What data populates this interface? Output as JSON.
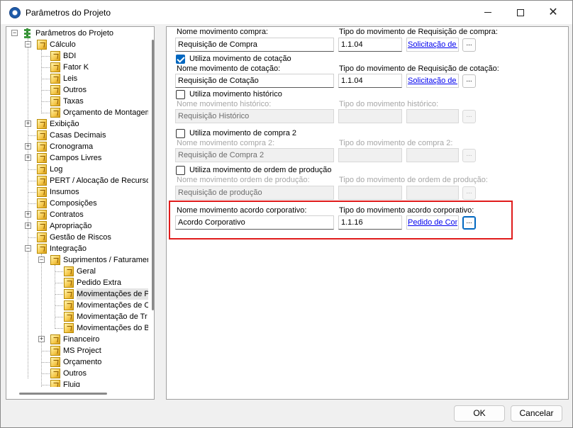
{
  "window": {
    "title": "Parâmetros do Projeto"
  },
  "tree": {
    "items": [
      "Parâmetros do Projeto",
      "Cálculo",
      "BDI",
      "Fator K",
      "Leis",
      "Outros",
      "Taxas",
      "Orçamento de Montagem",
      "Exibição",
      "Casas Decimais",
      "Cronograma",
      "Campos Livres",
      "Log",
      "PERT / Alocação de Recursos",
      "Insumos",
      "Composições",
      "Contratos",
      "Apropriação",
      "Gestão de Riscos",
      "Integração",
      "Suprimentos / Faturamento",
      "Geral",
      "Pedido Extra",
      "Movimentações de P",
      "Movimentações de C",
      "Movimentação de Tr",
      "Movimentações do B",
      "Financeiro",
      "MS Project",
      "Orçamento",
      "Outros",
      "Fluig"
    ]
  },
  "panel": {
    "compra": {
      "name_label": "Nome movimento compra:",
      "name_value": "Requisição de Compra",
      "type_label": "Tipo do movimento de Requisição de compra:",
      "type_value": "1.1.04",
      "link": "Solicitação de Compra",
      "ellipsis": "..."
    },
    "cotacao": {
      "check_label": "Utiliza movimento de cotação",
      "name_label": "Nome movimento de cotação:",
      "name_value": "Requisição de Cotação",
      "type_label": "Tipo do movimento de Requisição de cotação:",
      "type_value": "1.1.04",
      "link": "Solicitação de Compra",
      "ellipsis": "..."
    },
    "historico": {
      "check_label": "Utiliza movimento histórico",
      "name_label": "Nome movimento histórico:",
      "name_value": "Requisição Histórico",
      "type_label": "Tipo do movimento histórico:",
      "ellipsis": "..."
    },
    "compra2": {
      "check_label": "Utiliza movimento de compra 2",
      "name_label": "Nome movimento compra 2:",
      "name_value": "Requisição de Compra 2",
      "type_label": "Tipo do movimento de compra 2:",
      "ellipsis": "..."
    },
    "producao": {
      "check_label": "Utiliza movimento de ordem de produção",
      "name_label": "Nome movimento ordem de produção:",
      "name_value": "Requisição de produção",
      "type_label": "Tipo do movimento de ordem de produção:",
      "ellipsis": "..."
    },
    "corporativo": {
      "name_label": "Nome movimento acordo corporativo:",
      "name_value": "Acordo Corporativo",
      "type_label": "Tipo do movimento acordo corporativo:",
      "type_value": "1.1.16",
      "link": "Pedido de Compra",
      "ellipsis": "..."
    }
  },
  "footer": {
    "ok": "OK",
    "cancel": "Cancelar"
  },
  "colors": {
    "highlight": "#e01b1b",
    "accent": "#0067c0",
    "link": "#0000ee"
  }
}
